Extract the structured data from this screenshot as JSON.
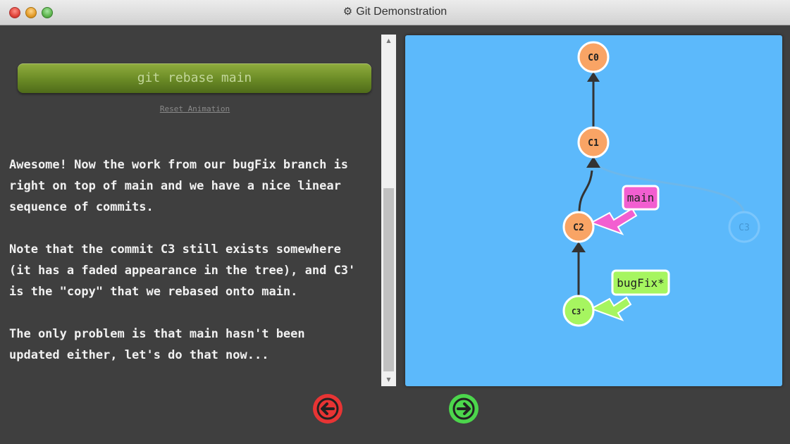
{
  "window": {
    "title": "Git Demonstration",
    "title_icon": "gear-icon"
  },
  "left": {
    "command_button": "git rebase main",
    "reset_link": "Reset Animation",
    "description": [
      [
        "Awesome! Now the work from our bugFix branch is",
        "right on top of main and we have a nice linear",
        "sequence of commits."
      ],
      [
        "Note that the commit C3 still exists somewhere",
        "(it has a faded appearance in the tree), and C3'",
        "is the \"copy\" that we rebased onto main."
      ],
      [
        "The only problem is that main hasn't been",
        "updated either, let's do that now..."
      ]
    ]
  },
  "graph": {
    "commits": [
      {
        "id": "C0",
        "label": "C0",
        "color": "#f9a465",
        "faded": false
      },
      {
        "id": "C1",
        "label": "C1",
        "color": "#f9a465",
        "faded": false
      },
      {
        "id": "C2",
        "label": "C2",
        "color": "#f9a465",
        "faded": false
      },
      {
        "id": "C3",
        "label": "C3",
        "color": "#5cb9fb",
        "faded": true
      },
      {
        "id": "C3p",
        "label": "C3'",
        "color": "#a6f560",
        "faded": false
      }
    ],
    "branches": [
      {
        "name": "main",
        "color": "#f25fd0",
        "target": "C2"
      },
      {
        "name": "bugFix*",
        "color": "#a6f560",
        "target": "C3p"
      }
    ],
    "canvas_color": "#5cb9fb"
  },
  "nav": {
    "back_color": "#e83434",
    "forward_color": "#4cd64c"
  }
}
